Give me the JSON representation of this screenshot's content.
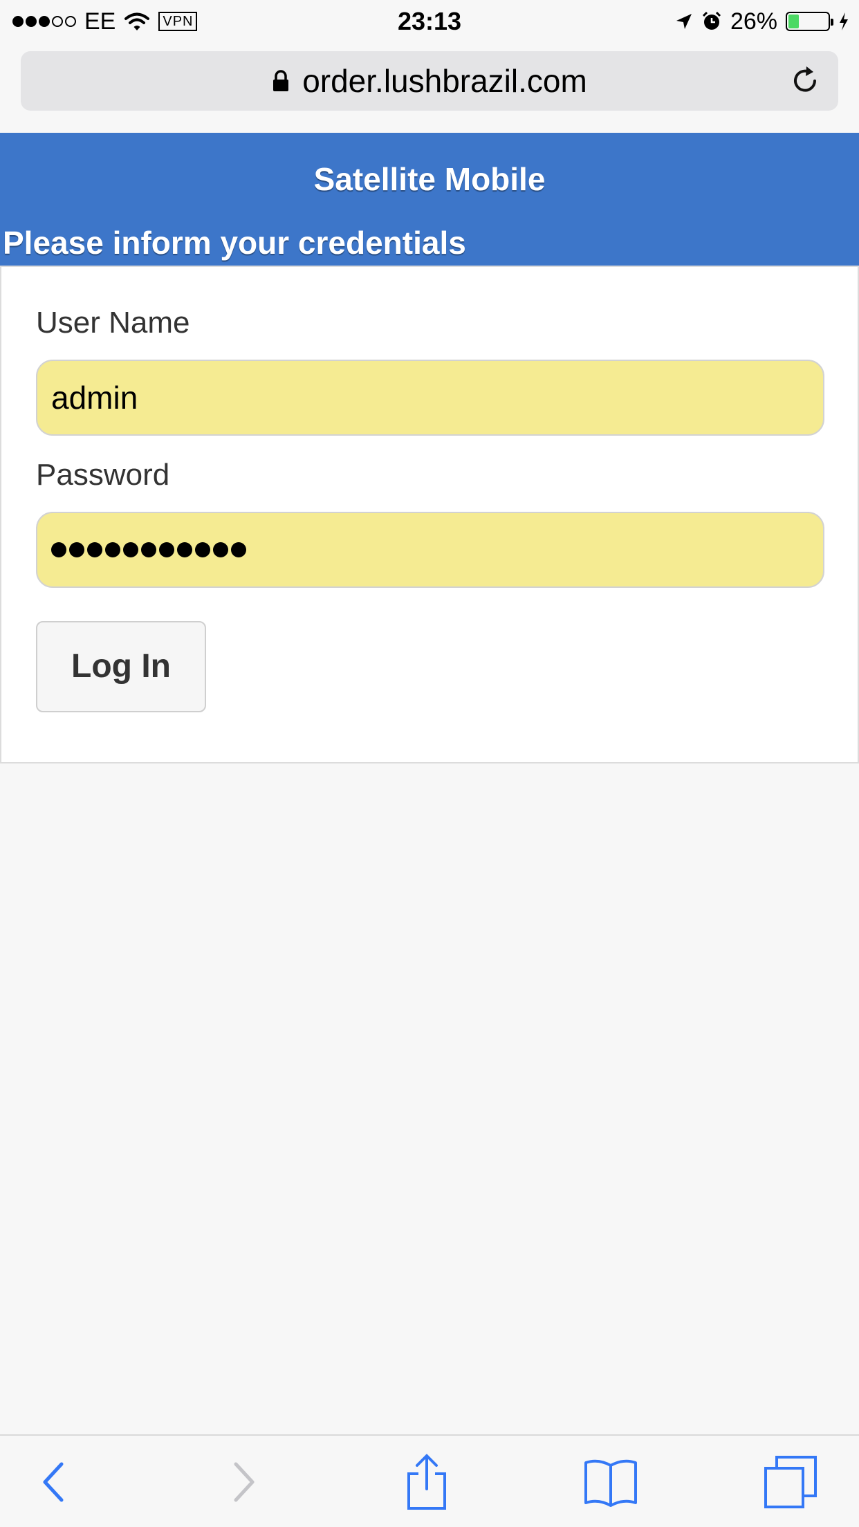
{
  "status_bar": {
    "carrier": "EE",
    "vpn_label": "VPN",
    "time": "23:13",
    "battery_percent": "26%",
    "battery_level": 0.26,
    "signal_bars_filled": 3,
    "signal_bars_total": 5,
    "icons": [
      "wifi-icon",
      "location-arrow-icon",
      "alarm-icon",
      "charging-bolt-icon"
    ]
  },
  "browser": {
    "url": "order.lushbrazil.com",
    "lock_icon": "lock-icon",
    "reload_icon": "reload-icon"
  },
  "header": {
    "title": "Satellite Mobile",
    "subtitle": "Please inform your credentials",
    "color": "#3d76c9"
  },
  "form": {
    "username_label": "User Name",
    "username_value": "admin",
    "password_label": "Password",
    "password_length": 11,
    "login_label": "Log In",
    "autofill_color": "#f5eb92"
  },
  "toolbar": {
    "items": [
      "back-icon",
      "forward-icon",
      "share-icon",
      "bookmarks-icon",
      "tabs-icon"
    ],
    "accent": "#3478f6"
  }
}
